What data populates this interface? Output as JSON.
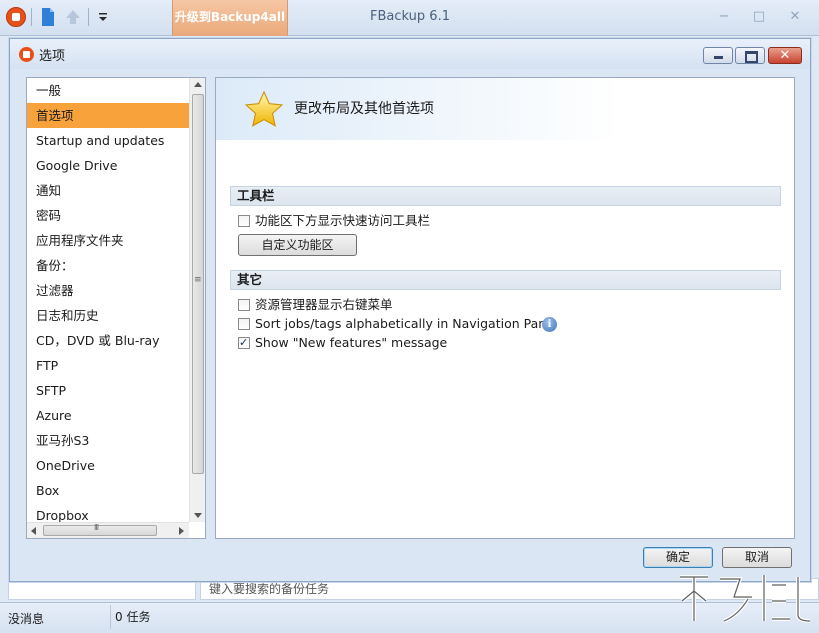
{
  "app": {
    "title": "FBackup 6.1",
    "upgrade_tab": "升级到Backup4all",
    "status_message": "没消息",
    "status_jobs": "0 任务",
    "search_placeholder": "键入要搜索的备份任务"
  },
  "dialog": {
    "title": "选项",
    "close_glyph": "✕",
    "nav_items": [
      {
        "label": "一般",
        "selected": false
      },
      {
        "label": "首选项",
        "selected": true
      },
      {
        "label": "Startup and updates",
        "selected": false
      },
      {
        "label": "Google Drive",
        "selected": false
      },
      {
        "label": "通知",
        "selected": false
      },
      {
        "label": "密码",
        "selected": false
      },
      {
        "label": "应用程序文件夹",
        "selected": false
      },
      {
        "label": "备份：",
        "selected": false
      },
      {
        "label": "过滤器",
        "selected": false
      },
      {
        "label": "日志和历史",
        "selected": false
      },
      {
        "label": "CD，DVD 或 Blu-ray",
        "selected": false
      },
      {
        "label": "FTP",
        "selected": false
      },
      {
        "label": "SFTP",
        "selected": false
      },
      {
        "label": "Azure",
        "selected": false
      },
      {
        "label": "亚马孙S3",
        "selected": false
      },
      {
        "label": "OneDrive",
        "selected": false
      },
      {
        "label": "Box",
        "selected": false
      },
      {
        "label": "Dropbox",
        "selected": false
      }
    ],
    "content": {
      "header_title": "更改布局及其他首选项",
      "toolbar_section": "工具栏",
      "show_qat_below": {
        "label": "功能区下方显示快速访问工具栏",
        "checked": false
      },
      "customize_button": "自定义功能区",
      "other_section": "其它",
      "explorer_menu": {
        "label": "资源管理器显示右键菜单",
        "checked": false
      },
      "sort_jobs": {
        "label": "Sort jobs/tags alphabetically in Navigation Pane",
        "checked": false
      },
      "new_features": {
        "label": "Show \"New features\" message",
        "checked": true
      },
      "info_glyph": "i"
    },
    "ok_button": "确定",
    "cancel_button": "取消"
  },
  "colors": {
    "accent_orange": "#f7a23b",
    "brand_red": "#e8501a",
    "window_bg": "#dbe6f4"
  }
}
